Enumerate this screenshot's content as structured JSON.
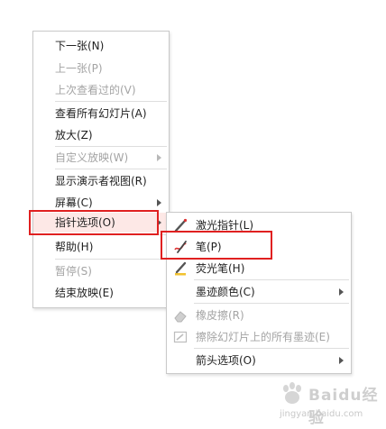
{
  "main_menu": {
    "next": "下一张(N)",
    "previous": "上一张(P)",
    "last_viewed": "上次查看过的(V)",
    "view_all": "查看所有幻灯片(A)",
    "zoom": "放大(Z)",
    "custom_show": "自定义放映(W)",
    "presenter_view": "显示演示者视图(R)",
    "screen": "屏幕(C)",
    "pointer_options": "指针选项(O)",
    "help": "帮助(H)",
    "pause": "暂停(S)",
    "end_show": "结束放映(E)"
  },
  "sub_menu": {
    "laser_pointer": "激光指针(L)",
    "pen": "笔(P)",
    "highlighter": "荧光笔(H)",
    "ink_color": "墨迹颜色(C)",
    "eraser": "橡皮擦(R)",
    "erase_all": "擦除幻灯片上的所有墨迹(E)",
    "arrow_options": "箭头选项(O)"
  },
  "watermark": {
    "logo_text": "Baidu经验",
    "url": "jingyan.baidu.com"
  },
  "colors": {
    "highlight_bg": "#fde8e6",
    "annotation_red": "#e02020",
    "disabled_text": "#a4a4a4"
  }
}
